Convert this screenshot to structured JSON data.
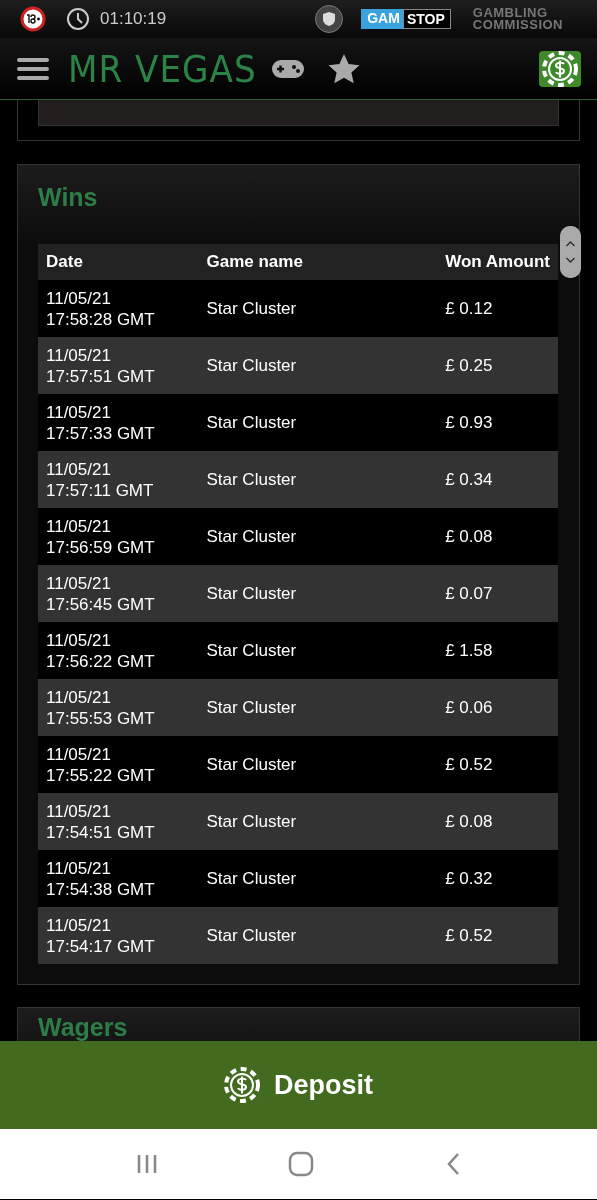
{
  "status_bar": {
    "time": "01:10:19",
    "gamstop": [
      "GAM",
      "STOP"
    ],
    "commission": [
      "GAMBLING",
      "COMMISSION"
    ]
  },
  "header": {
    "logo": "MR VEGAS"
  },
  "wins": {
    "title": "Wins",
    "columns": [
      "Date",
      "Game name",
      "Won Amount"
    ],
    "rows": [
      {
        "date": "11/05/21",
        "time": "17:58:28 GMT",
        "game": "Star Cluster",
        "amount": "£ 0.12"
      },
      {
        "date": "11/05/21",
        "time": "17:57:51 GMT",
        "game": "Star Cluster",
        "amount": "£ 0.25"
      },
      {
        "date": "11/05/21",
        "time": "17:57:33 GMT",
        "game": "Star Cluster",
        "amount": "£ 0.93"
      },
      {
        "date": "11/05/21",
        "time": "17:57:11 GMT",
        "game": "Star Cluster",
        "amount": "£ 0.34"
      },
      {
        "date": "11/05/21",
        "time": "17:56:59 GMT",
        "game": "Star Cluster",
        "amount": "£ 0.08"
      },
      {
        "date": "11/05/21",
        "time": "17:56:45 GMT",
        "game": "Star Cluster",
        "amount": "£ 0.07"
      },
      {
        "date": "11/05/21",
        "time": "17:56:22 GMT",
        "game": "Star Cluster",
        "amount": "£ 1.58"
      },
      {
        "date": "11/05/21",
        "time": "17:55:53 GMT",
        "game": "Star Cluster",
        "amount": "£ 0.06"
      },
      {
        "date": "11/05/21",
        "time": "17:55:22 GMT",
        "game": "Star Cluster",
        "amount": "£ 0.52"
      },
      {
        "date": "11/05/21",
        "time": "17:54:51 GMT",
        "game": "Star Cluster",
        "amount": "£ 0.08"
      },
      {
        "date": "11/05/21",
        "time": "17:54:38 GMT",
        "game": "Star Cluster",
        "amount": "£ 0.32"
      },
      {
        "date": "11/05/21",
        "time": "17:54:17 GMT",
        "game": "Star Cluster",
        "amount": "£ 0.52"
      }
    ]
  },
  "wagers": {
    "title": "Wagers"
  },
  "deposit_button": {
    "label": "Deposit"
  }
}
